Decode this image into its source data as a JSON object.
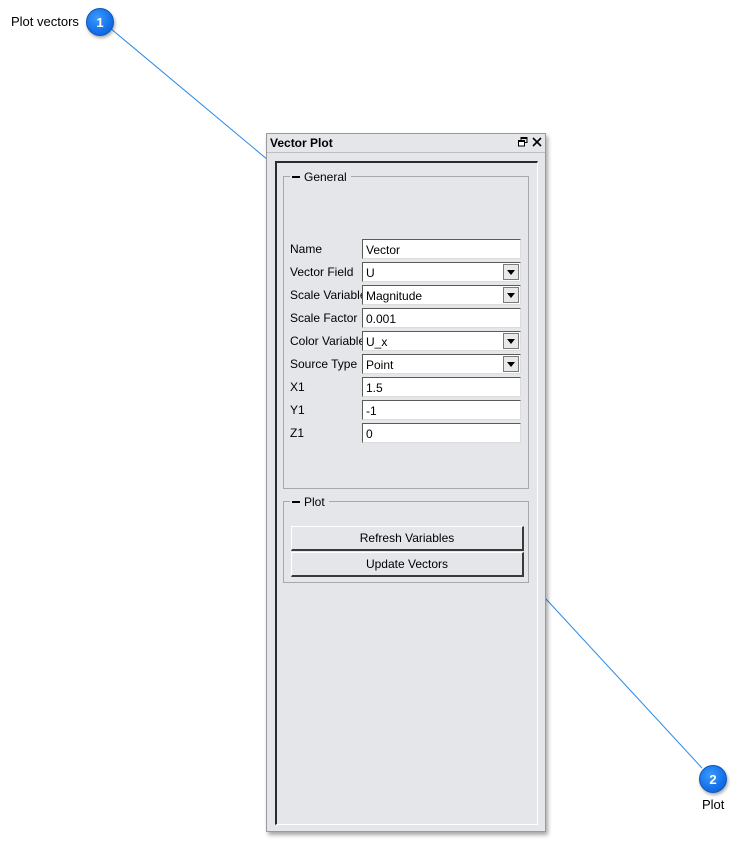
{
  "callouts": [
    {
      "number": "1",
      "label": "Plot vectors"
    },
    {
      "number": "2",
      "label": "Plot"
    }
  ],
  "window": {
    "title": "Vector Plot",
    "restore_icon": "restore-icon",
    "close_icon": "close-icon"
  },
  "general": {
    "legend": "General",
    "fields": [
      {
        "label": "Name",
        "value": "Vector",
        "type": "text"
      },
      {
        "label": "Vector Field",
        "value": "U",
        "type": "select"
      },
      {
        "label": "Scale Variable",
        "value": "Magnitude",
        "type": "select"
      },
      {
        "label": "Scale Factor",
        "value": "0.001",
        "type": "text"
      },
      {
        "label": "Color Variable",
        "value": "U_x",
        "type": "select"
      },
      {
        "label": "Source Type",
        "value": "Point",
        "type": "select"
      },
      {
        "label": "X1",
        "value": "1.5",
        "type": "text"
      },
      {
        "label": "Y1",
        "value": "-1",
        "type": "text"
      },
      {
        "label": "Z1",
        "value": "0",
        "type": "text"
      }
    ]
  },
  "plot": {
    "legend": "Plot",
    "refresh_label": "Refresh Variables",
    "update_label": "Update Vectors"
  },
  "colors": {
    "panel_bg": "#e4e6ea",
    "callout_badge": "#1470e8",
    "callout_line": "#2a8ae6"
  }
}
